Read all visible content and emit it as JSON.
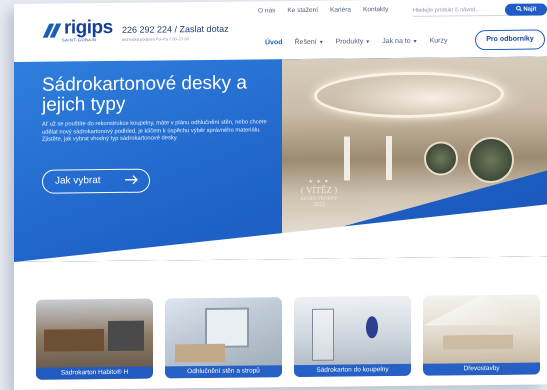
{
  "header": {
    "logo": "rigips",
    "logo_sub": "SAINT-GOBAIN",
    "phone": "226 292 224 / Zaslat dotaz",
    "phone_sub": "technická podpora Po–Pa 7:00–17:00",
    "topnav": [
      "O nás",
      "Ke stažení",
      "Kariéra",
      "Kontakty"
    ],
    "search_placeholder": "Hledejte produkt či návod...",
    "search_button": "Najít",
    "mainnav": [
      {
        "label": "Úvod",
        "active": true,
        "caret": false
      },
      {
        "label": "Řešení",
        "active": false,
        "caret": true
      },
      {
        "label": "Produkty",
        "active": false,
        "caret": true
      },
      {
        "label": "Jak na to",
        "active": false,
        "caret": true
      },
      {
        "label": "Kurzy",
        "active": false,
        "caret": false
      }
    ],
    "pro_button": "Pro odborníky"
  },
  "hero": {
    "title": "Sádrokartonové desky a jejich typy",
    "description": "Ať už se pouštíte do rekonstrukce koupelny, máte v plánu odhlučnění stěn, nebo chcete udělat nový sádrokartonový podhled, je klíčem k úspěchu výběr správného materiálu. Zjistěte, jak vybrat vhodný typ sádrokartonové desky.",
    "cta": "Jak vybrat",
    "trophy": {
      "stars": "★ ★ ★",
      "title": "VÍTĚZ",
      "name": "RIGIPS TROPHY",
      "year": "2022"
    }
  },
  "cards": [
    {
      "label": "Sádrokarton Habito® H"
    },
    {
      "label": "Odhlučnění stěn a stropů"
    },
    {
      "label": "Sádrokarton do koupelny"
    },
    {
      "label": "Dřevostavby"
    }
  ],
  "colors": {
    "brand": "#1f5cc6",
    "logo": "#14409a",
    "hero_blue": "#2f7fdc"
  }
}
